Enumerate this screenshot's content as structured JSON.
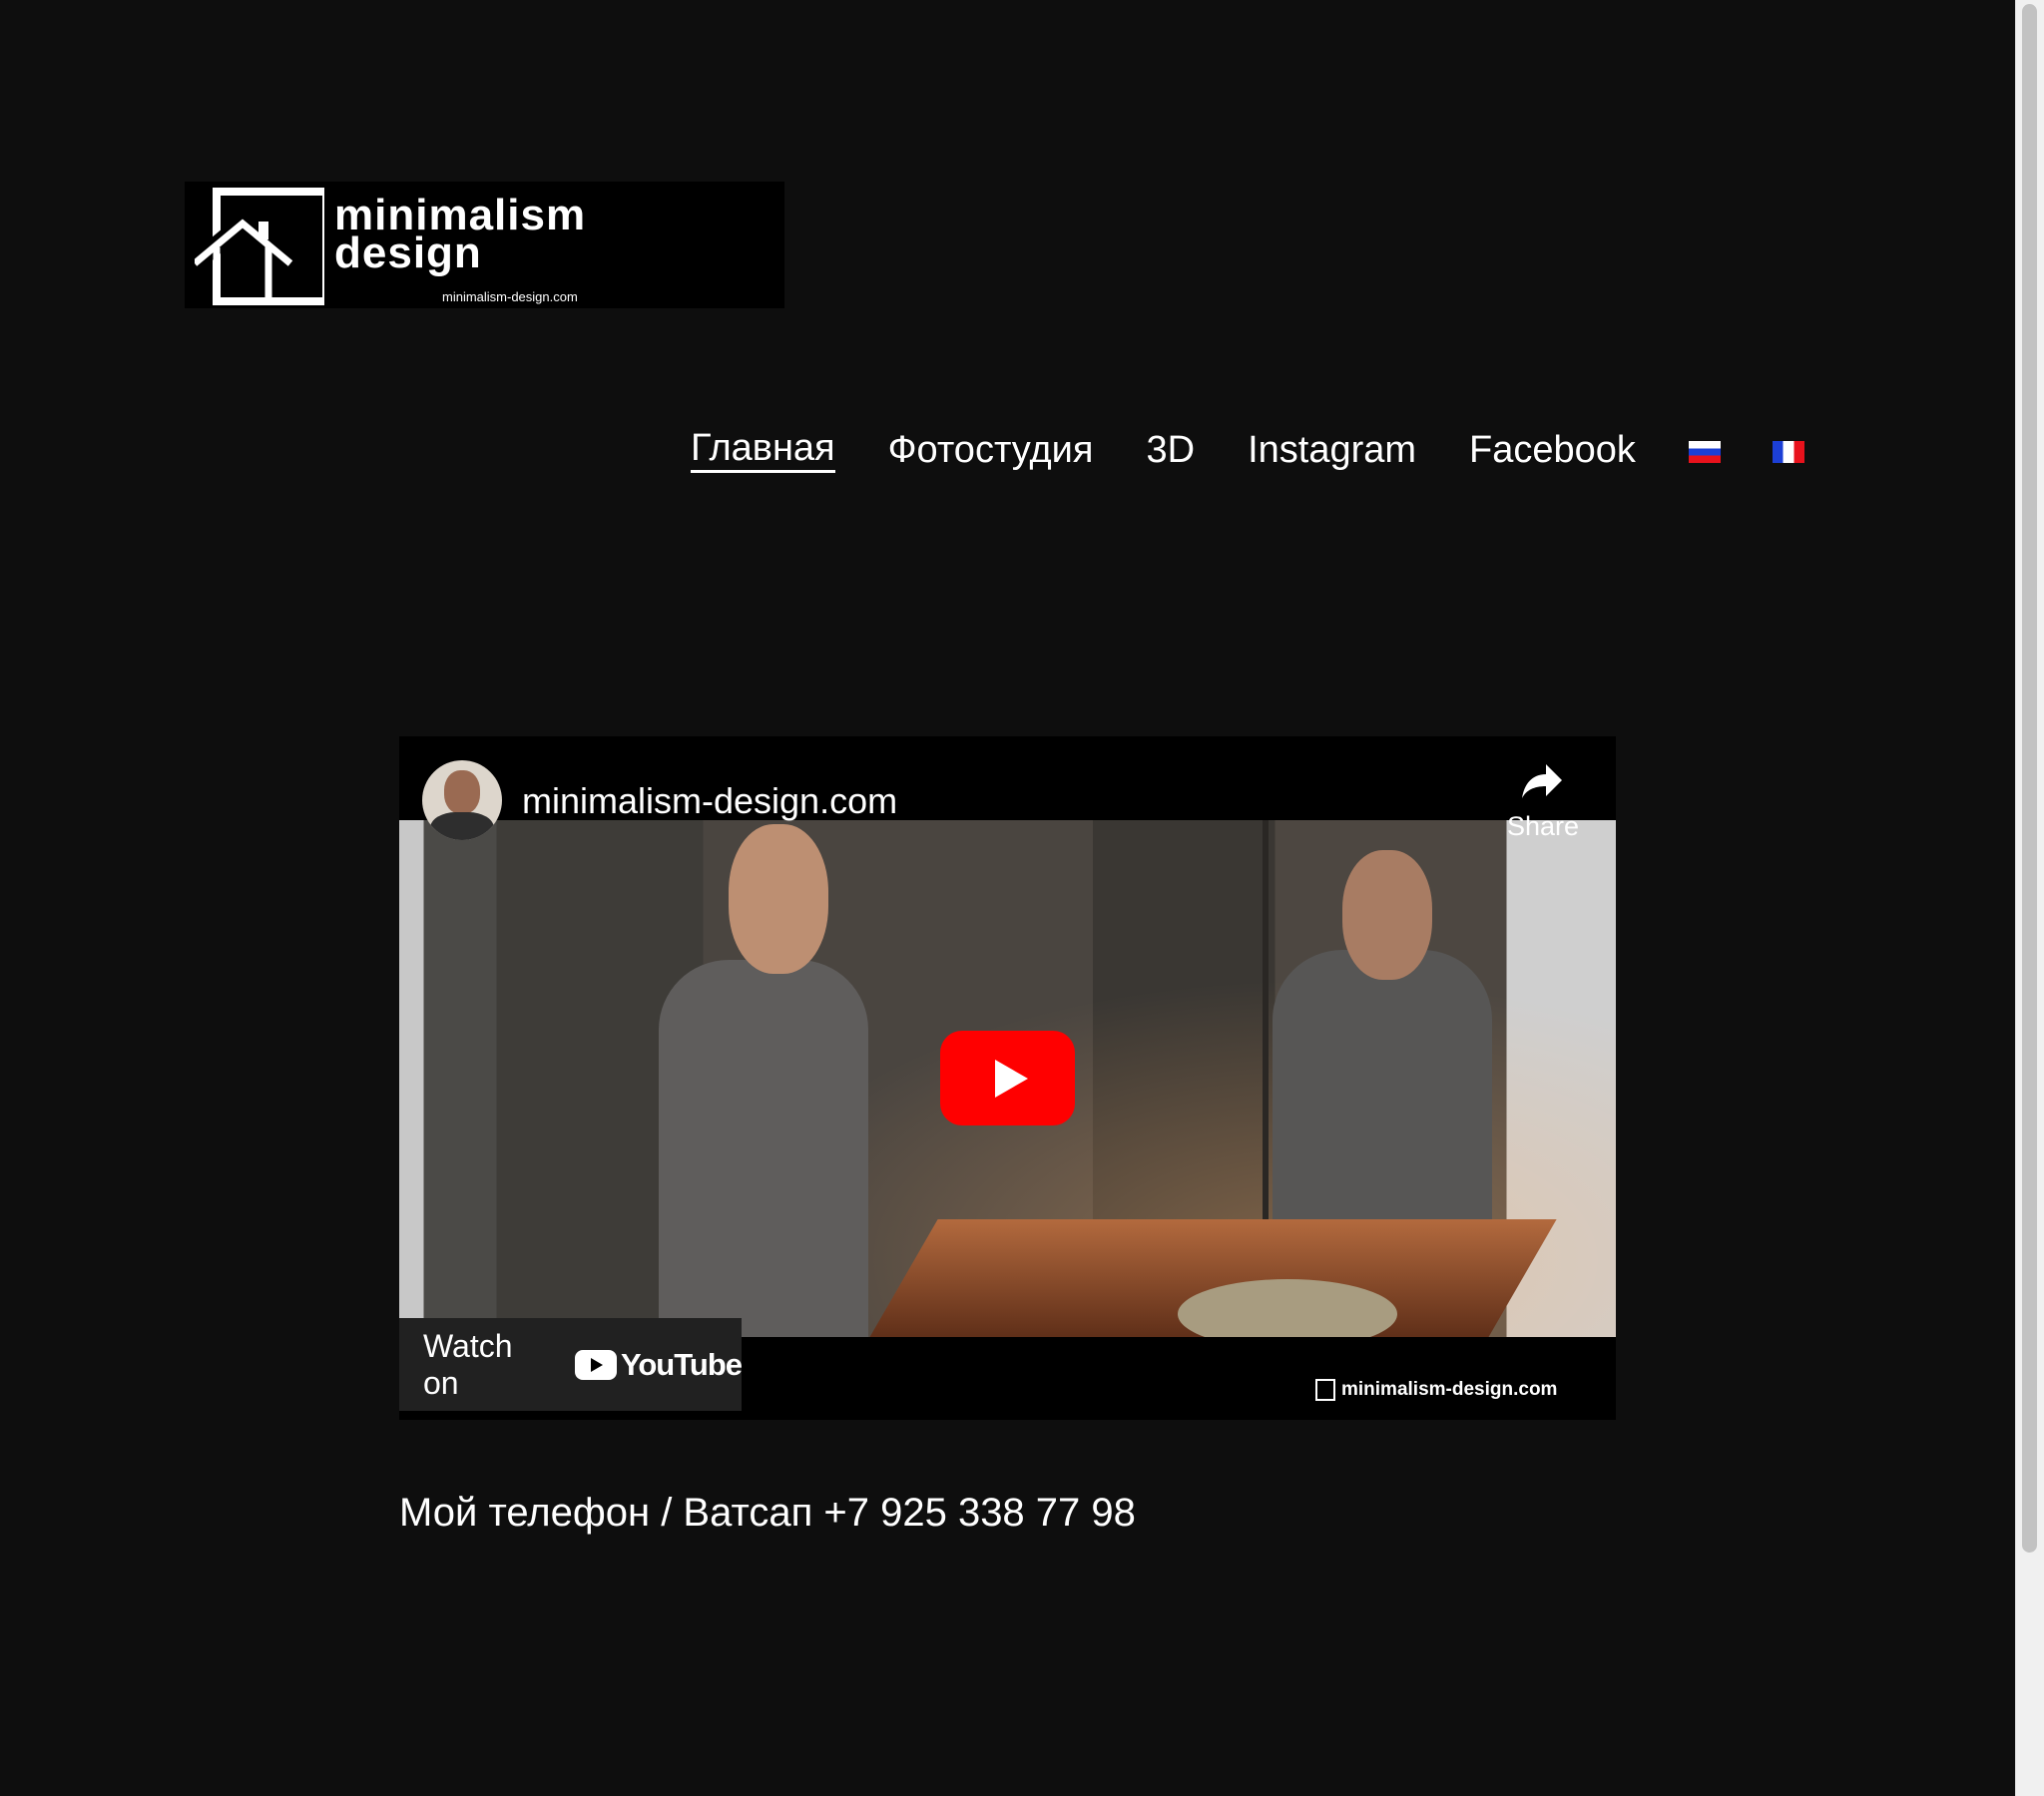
{
  "logo": {
    "line1": "minimalism",
    "line2": "design",
    "url": "minimalism-design.com"
  },
  "nav": {
    "items": [
      {
        "label": "Главная",
        "active": true
      },
      {
        "label": "Фотостудия"
      },
      {
        "label": "3D"
      },
      {
        "label": "Instagram"
      },
      {
        "label": "Facebook"
      }
    ],
    "flags": [
      "ru-flag-icon",
      "fr-flag-icon"
    ]
  },
  "video": {
    "channel_title": "minimalism-design.com",
    "share_label": "Share",
    "watch_on_label": "Watch on",
    "youtube_label": "YouTube",
    "watermark": "minimalism-design.com",
    "play_color": "#ff0000"
  },
  "contact": {
    "text": "Мой телефон / Ватсап +7 925 338 77 98"
  }
}
